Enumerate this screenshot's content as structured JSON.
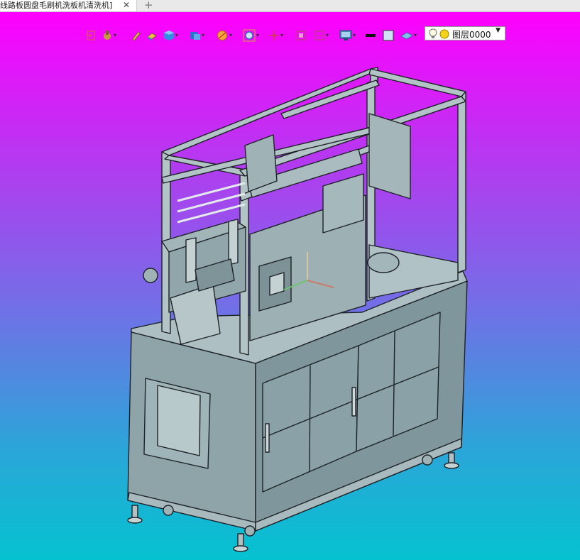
{
  "document_tab": {
    "title": "线路板圆盘毛刷机洗板机清洗机]",
    "close_glyph": "✕",
    "new_tab_glyph": "+"
  },
  "toolbar": {
    "items": [
      {
        "name": "exit-sketch-icon"
      },
      {
        "name": "snap-icon"
      },
      {
        "name": "pen-icon"
      },
      {
        "name": "eraser-icon"
      },
      {
        "name": "render-mode-icon"
      },
      {
        "name": "view-orientation-icon"
      },
      {
        "name": "section-icon"
      },
      {
        "name": "zoom-icon"
      },
      {
        "name": "pan-icon"
      },
      {
        "name": "zoom-window-icon"
      },
      {
        "name": "display-range-icon"
      },
      {
        "name": "monitor-icon"
      },
      {
        "name": "line-color-icon"
      },
      {
        "name": "fill-color-icon"
      },
      {
        "name": "material-icon"
      }
    ],
    "layer_select": {
      "value": "图层0000",
      "caret": "▼"
    }
  },
  "viewport": {
    "background_top": "#ff00ff",
    "background_bottom": "#05c2d0",
    "model_fill": "#8fa8ad",
    "model_edge": "#1d2226"
  }
}
